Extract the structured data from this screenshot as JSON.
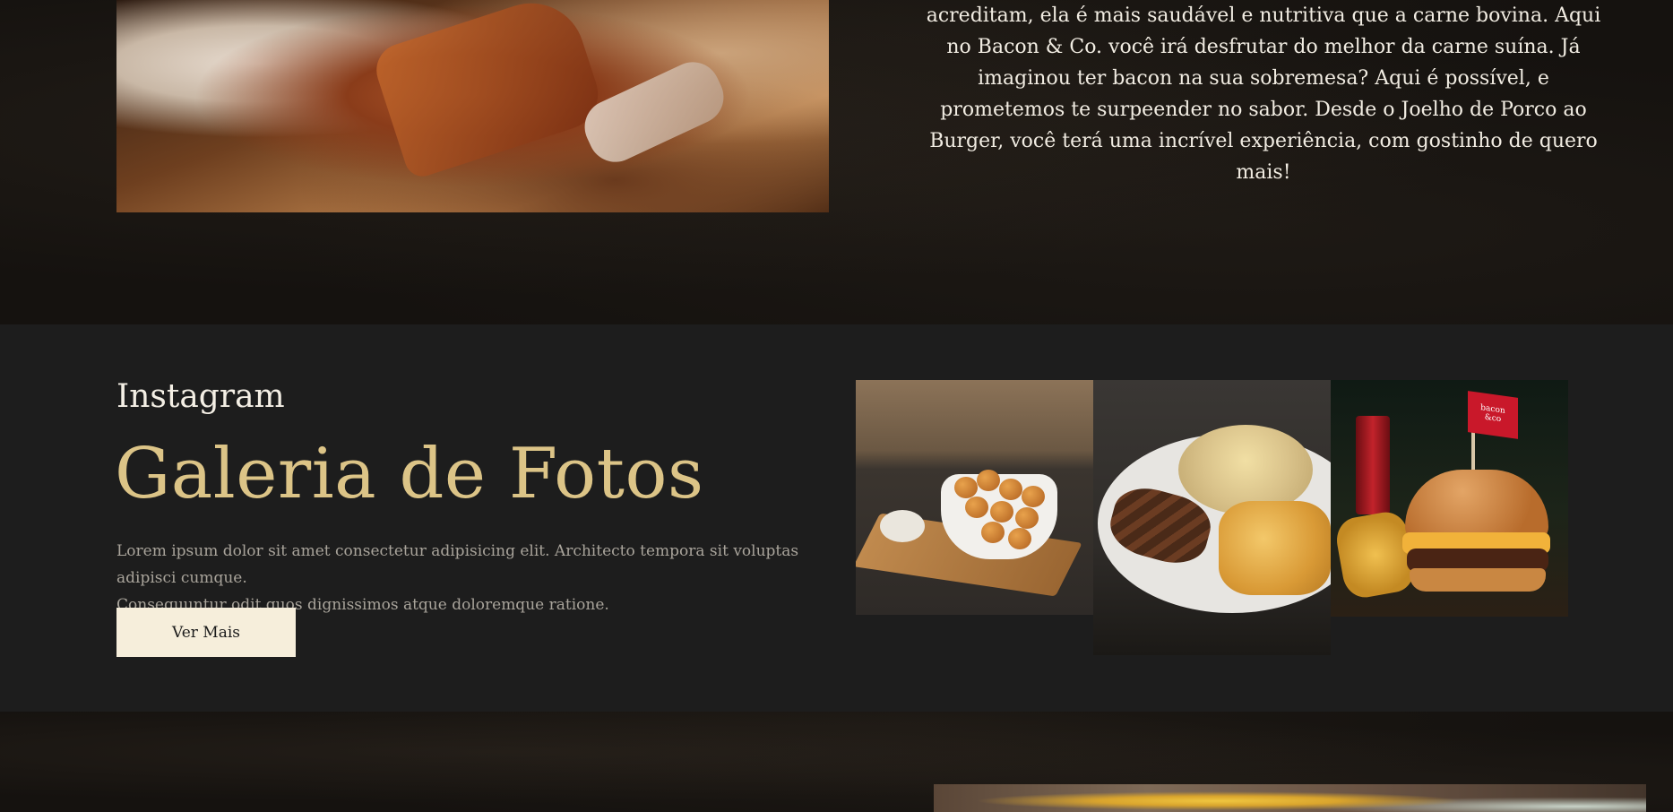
{
  "about": {
    "lines": [
      "acreditam, ela é mais saudável e nutritiva que a carne bovina. Aqui",
      "no Bacon & Co. você irá desfrutar do melhor da carne suína. Já",
      "imaginou ter bacon na sua sobremesa? Aqui é possível, e",
      "prometemos te surpeender no sabor. Desde o Joelho de Porco ao",
      "Burger, você terá uma incrível experiência, com gostinho de quero",
      "mais!"
    ]
  },
  "instagram": {
    "label": "Instagram",
    "title": "Galeria de Fotos",
    "description_lines": [
      "Lorem ipsum dolor sit amet consectetur adipisicing elit. Architecto tempora sit voluptas adipisci cumque.",
      "Consequuntur odit quos dignissimos atque doloremque ratione."
    ],
    "button_label": "Ver Mais",
    "burger_flag_text": [
      "bacon",
      "&co"
    ]
  },
  "colors": {
    "gallery_title": "#dcc487",
    "button_bg": "#f6eedb",
    "section_bg": "#1d1d1d"
  }
}
